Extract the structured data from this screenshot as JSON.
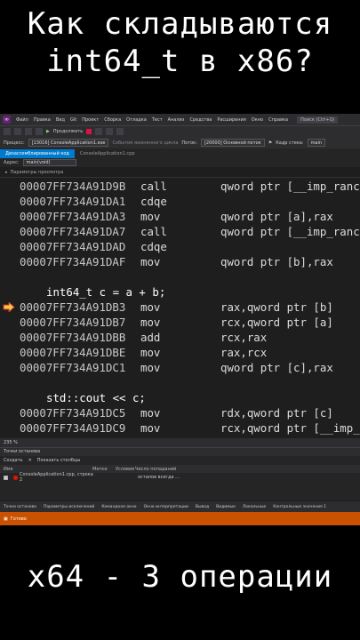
{
  "captions": {
    "top_line1": "Как складываются",
    "top_line2": "int64_t в x86?",
    "bottom": "x64 - 3 операции"
  },
  "menu": {
    "items": [
      "Файл",
      "Правка",
      "Вид",
      "Git",
      "Проект",
      "Сборка",
      "Отладка",
      "Тест",
      "Анализ",
      "Средства",
      "Расширения",
      "Окно",
      "Справка"
    ],
    "search": "Поиск (Ctrl+Q)"
  },
  "toolbar": {
    "continue_label": "Продолжить"
  },
  "debug_bar": {
    "process_label": "Процесс:",
    "process_value": "[13016] ConsoleApplication1.exe",
    "lifecycle_label": "События жизненного цикла",
    "thread_label": "Поток:",
    "thread_value": "[20000] Основной поток",
    "stack_label": "Кадр стека:",
    "stack_value": "main"
  },
  "tabs": {
    "active": "Дизассемблированный код",
    "other": "ConsoleApplication1.cpp"
  },
  "address": {
    "label": "Адрес:",
    "value": "main(void)"
  },
  "view_options": "Параметры просмотра",
  "code_lines": [
    {
      "kind": "asm",
      "addr": "00007FF734A91D9B",
      "op": "call",
      "args": "qword ptr [__imp_ranc"
    },
    {
      "kind": "asm",
      "addr": "00007FF734A91DA1",
      "op": "cdqe",
      "args": ""
    },
    {
      "kind": "asm",
      "addr": "00007FF734A91DA3",
      "op": "mov",
      "args": "qword ptr [a],rax"
    },
    {
      "kind": "asm",
      "addr": "00007FF734A91DA7",
      "op": "call",
      "args": "qword ptr [__imp_ranc"
    },
    {
      "kind": "asm",
      "addr": "00007FF734A91DAD",
      "op": "cdqe",
      "args": ""
    },
    {
      "kind": "asm",
      "addr": "00007FF734A91DAF",
      "op": "mov",
      "args": "qword ptr [b],rax"
    },
    {
      "kind": "blank"
    },
    {
      "kind": "src",
      "text": "int64_t c = a + b;"
    },
    {
      "kind": "asm",
      "addr": "00007FF734A91DB3",
      "op": "mov",
      "args": "rax,qword ptr [b]",
      "current": true
    },
    {
      "kind": "asm",
      "addr": "00007FF734A91DB7",
      "op": "mov",
      "args": "rcx,qword ptr [a]"
    },
    {
      "kind": "asm",
      "addr": "00007FF734A91DBB",
      "op": "add",
      "args": "rcx,rax"
    },
    {
      "kind": "asm",
      "addr": "00007FF734A91DBE",
      "op": "mov",
      "args": "rax,rcx"
    },
    {
      "kind": "asm",
      "addr": "00007FF734A91DC1",
      "op": "mov",
      "args": "qword ptr [c],rax"
    },
    {
      "kind": "blank"
    },
    {
      "kind": "src",
      "text": "std::cout << c;"
    },
    {
      "kind": "asm",
      "addr": "00007FF734A91DC5",
      "op": "mov",
      "args": "rdx,qword ptr [c]"
    },
    {
      "kind": "asm",
      "addr": "00007FF734A91DC9",
      "op": "mov",
      "args": "rcx,qword ptr [__imp_"
    }
  ],
  "zoom": "235 %",
  "breakpoints": {
    "title": "Точки останова",
    "create_label": "Создать",
    "columns_label": "Показать столбцы",
    "headers": [
      "Имя",
      "Метки",
      "Условие",
      "Число попаданий"
    ],
    "rows": [
      {
        "name": "ConsoleApplication1.cpp, строка 2",
        "labels": "",
        "condition": "",
        "hits": "остапов всегда ..."
      }
    ]
  },
  "bottom_tabs": [
    "Точки останова",
    "Параметры исключений",
    "Командное окно",
    "Окно интерпретации",
    "Вывод",
    "Видимые",
    "Локальные",
    "Контрольные значения 1"
  ],
  "status": "Готово"
}
